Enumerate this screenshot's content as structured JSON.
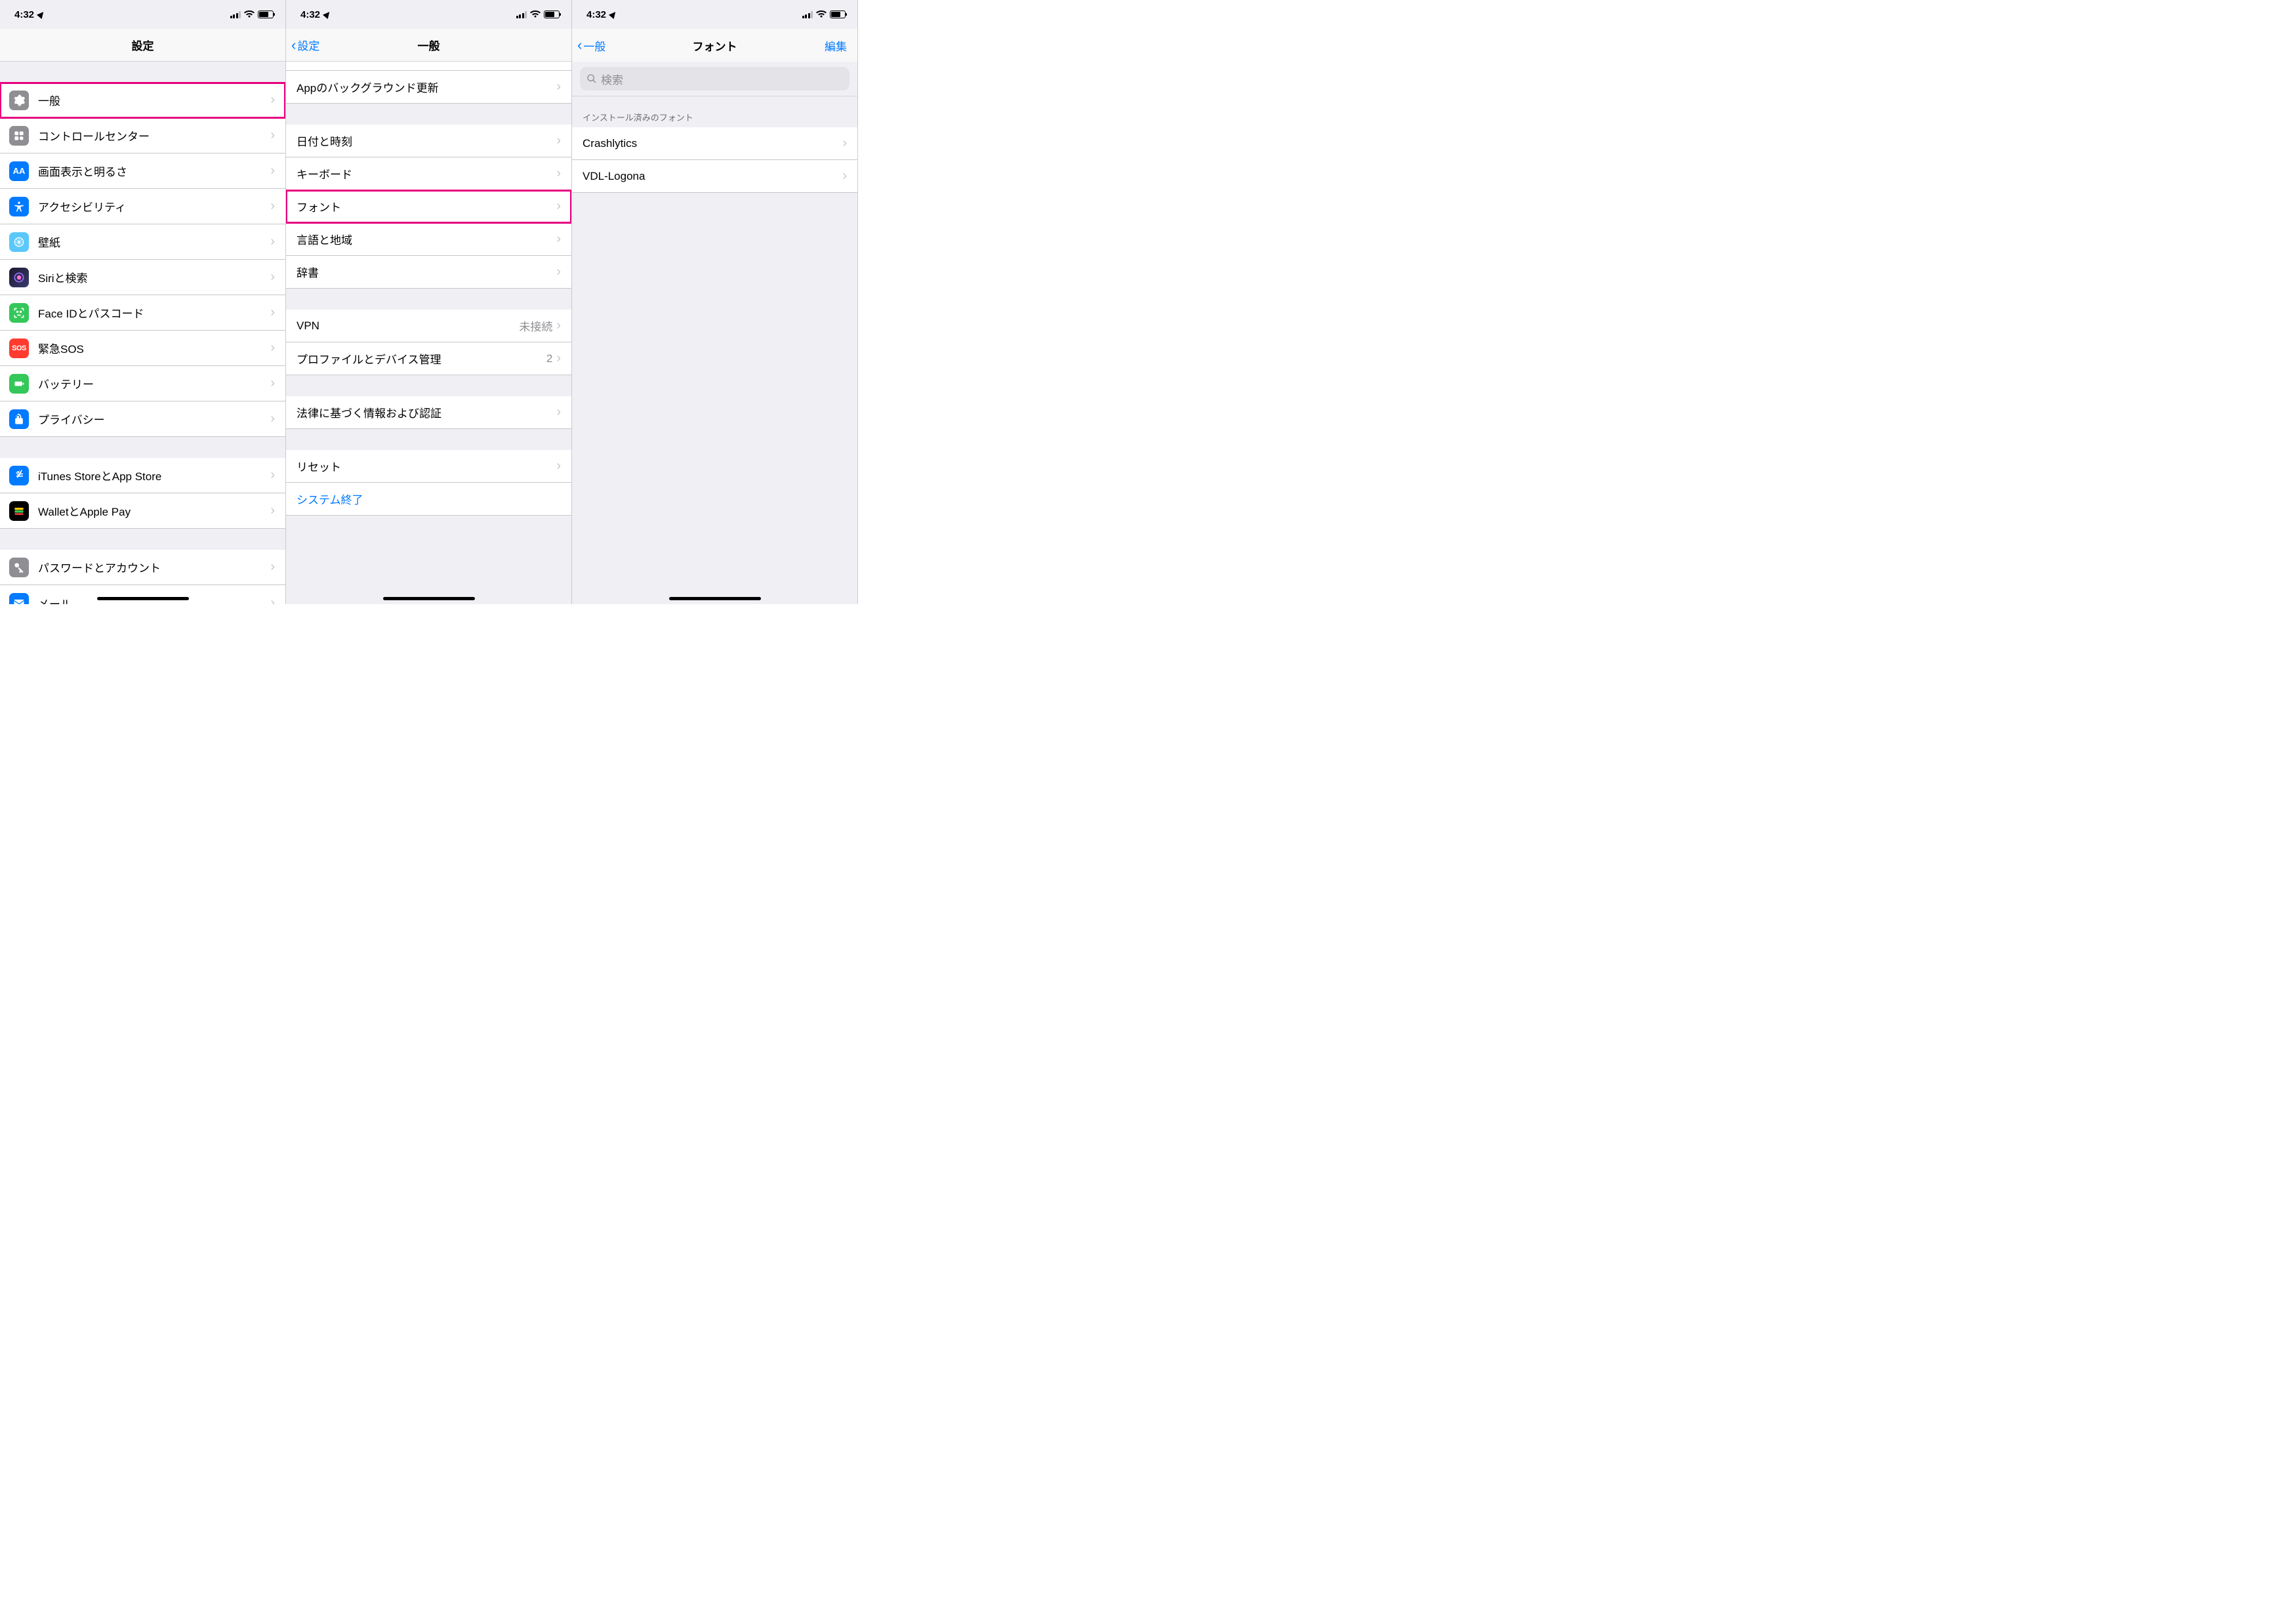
{
  "time": "4:32",
  "phone1": {
    "nav_title": "設定",
    "rows": {
      "general": "一般",
      "control_center": "コントロールセンター",
      "display": "画面表示と明るさ",
      "accessibility": "アクセシビリティ",
      "wallpaper": "壁紙",
      "siri": "Siriと検索",
      "faceid": "Face IDとパスコード",
      "sos": "緊急SOS",
      "battery": "バッテリー",
      "privacy": "プライバシー",
      "itunes": "iTunes StoreとApp Store",
      "wallet": "WalletとApple Pay",
      "passwords": "パスワードとアカウント",
      "mail": "メール"
    },
    "sos_label": "SOS"
  },
  "phone2": {
    "back": "設定",
    "nav_title": "一般",
    "rows": {
      "bg_refresh": "Appのバックグラウンド更新",
      "date_time": "日付と時刻",
      "keyboard": "キーボード",
      "font": "フォント",
      "lang": "言語と地域",
      "dict": "辞書",
      "vpn": "VPN",
      "vpn_status": "未接続",
      "profile": "プロファイルとデバイス管理",
      "profile_count": "2",
      "legal": "法律に基づく情報および認証",
      "reset": "リセット",
      "shutdown": "システム終了"
    }
  },
  "phone3": {
    "back": "一般",
    "nav_title": "フォント",
    "edit": "編集",
    "search_placeholder": "検索",
    "section_header": "インストール済みのフォント",
    "rows": {
      "font1": "Crashlytics",
      "font2": "VDL-Logona"
    }
  }
}
